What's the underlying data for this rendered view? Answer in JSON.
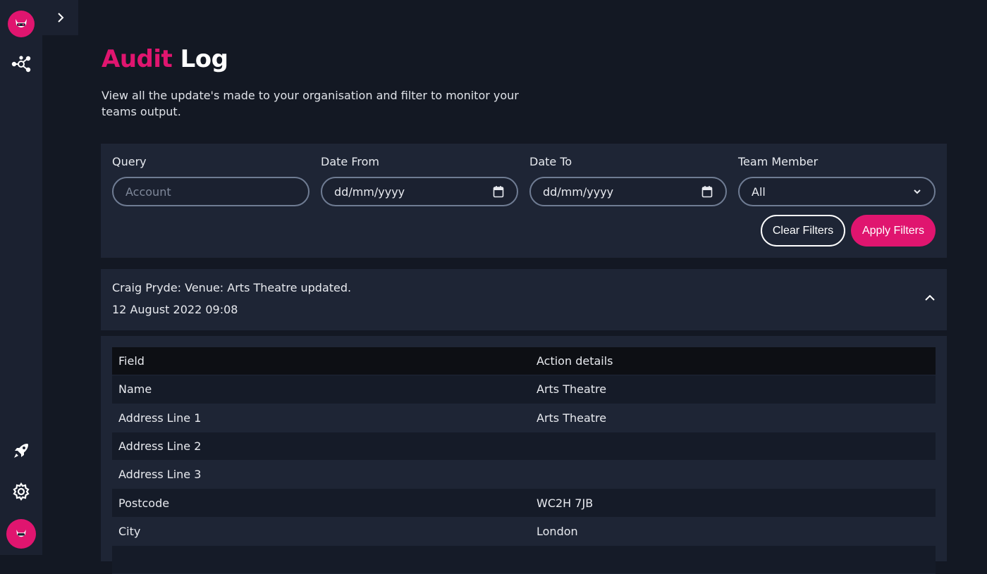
{
  "nav": {
    "items": [
      {
        "name": "logo-avatar-icon"
      },
      {
        "name": "network-icon"
      },
      {
        "name": "rocket-icon"
      },
      {
        "name": "gear-icon"
      },
      {
        "name": "user-avatar-icon"
      }
    ],
    "expand_icon": "chevron-right-icon"
  },
  "header": {
    "title_accent": "Audit",
    "title_rest": "Log",
    "subtitle": "View all the update's made to your organisation and filter to monitor your teams output."
  },
  "filters": {
    "query": {
      "label": "Query",
      "placeholder": "Account",
      "value": ""
    },
    "date_from": {
      "label": "Date From",
      "value": "dd/mm/yyyy"
    },
    "date_to": {
      "label": "Date To",
      "value": "dd/mm/yyyy"
    },
    "team_member": {
      "label": "Team Member",
      "value": "All"
    },
    "clear_label": "Clear Filters",
    "apply_label": "Apply Filters"
  },
  "entry": {
    "title": "Craig Pryde: Venue: Arts Theatre updated.",
    "date": "12 August 2022 09:08",
    "expanded": true
  },
  "details": {
    "columns": [
      "Field",
      "Action details"
    ],
    "rows": [
      [
        "Name",
        "Arts Theatre"
      ],
      [
        "Address Line 1",
        "Arts Theatre"
      ],
      [
        "Address Line 2",
        ""
      ],
      [
        "Address Line 3",
        ""
      ],
      [
        "Postcode",
        "WC2H 7JB"
      ],
      [
        "City",
        "London"
      ],
      [
        "",
        ""
      ]
    ]
  },
  "colors": {
    "accent": "#e0156f",
    "background": "#131823",
    "panel": "#1e2535"
  }
}
